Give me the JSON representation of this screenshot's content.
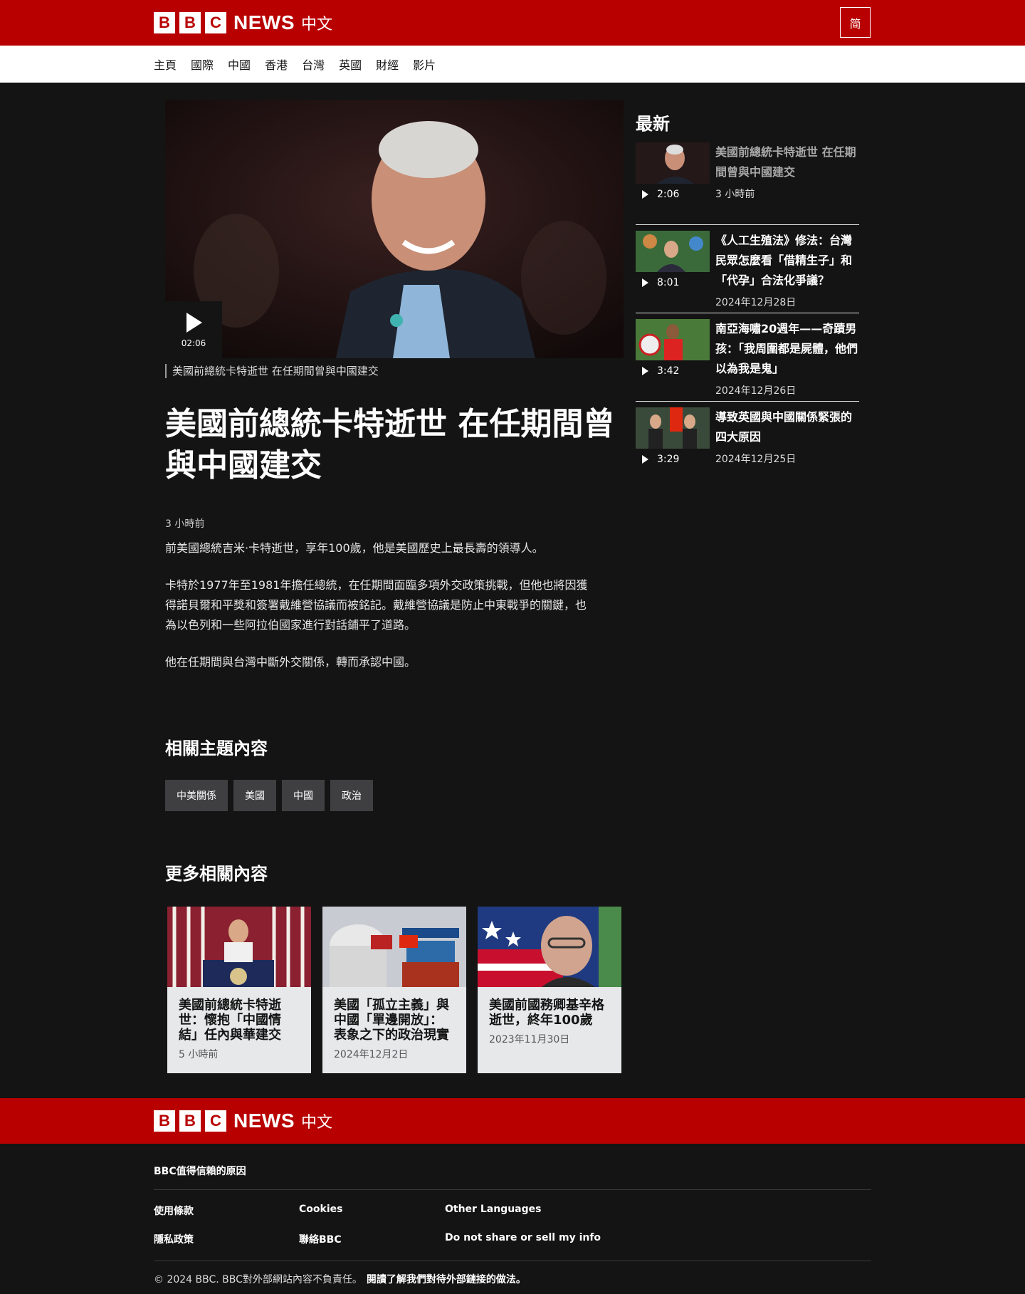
{
  "brand": {
    "letters": [
      "B",
      "B",
      "C"
    ],
    "news": "NEWS",
    "chinese": "中文"
  },
  "header": {
    "lang_toggle": "简"
  },
  "nav": [
    "主頁",
    "國際",
    "中國",
    "香港",
    "台灣",
    "英國",
    "財經",
    "影片"
  ],
  "video": {
    "duration": "02:06",
    "caption": "美國前總統卡特逝世 在任期間曾與中國建交"
  },
  "article": {
    "title": "美國前總統卡特逝世 在任期間曾與中國建交",
    "time": "3 小時前",
    "paragraphs": [
      "前美國總統吉米·卡特逝世，享年100歲，他是美國歷史上最長壽的領導人。",
      "卡特於1977年至1981年擔任總統，在任期間面臨多項外交政策挑戰，但他也將因獲得諾貝爾和平獎和簽署戴維營協議而被銘記。戴維營協議是防止中東戰爭的關鍵，也為以色列和一些阿拉伯國家進行對話鋪平了道路。",
      "他在任期間與台灣中斷外交關係，轉而承認中國。"
    ]
  },
  "topics": {
    "heading": "相關主題內容",
    "tags": [
      "中美關係",
      "美國",
      "中國",
      "政治"
    ]
  },
  "more": {
    "heading": "更多相關內容",
    "cards": [
      {
        "title": "美國前總統卡特逝世：懷抱「中國情結」任內與華建交",
        "date": "5 小時前"
      },
      {
        "title": "美國「孤立主義」與中國「單邊開放」：表象之下的政治現實",
        "date": "2024年12月2日"
      },
      {
        "title": "美國前國務卿基辛格逝世，終年100歲",
        "date": "2023年11月30日"
      }
    ]
  },
  "sidebar": {
    "heading": "最新",
    "items": [
      {
        "title": "美國前總統卡特逝世 在任期間曾與中國建交",
        "duration": "2:06",
        "date": "3 小時前"
      },
      {
        "title": "《人工生殖法》修法：台灣民眾怎麼看「借精生子」和「代孕」合法化爭議？",
        "duration": "8:01",
        "date": "2024年12月28日"
      },
      {
        "title": "南亞海嘯20週年——奇蹟男孩：「我周圍都是屍體，他們以為我是鬼」",
        "duration": "3:42",
        "date": "2024年12月26日"
      },
      {
        "title": "導致英國與中國關係緊張的四大原因",
        "duration": "3:29",
        "date": "2024年12月25日"
      }
    ]
  },
  "footer": {
    "why": "BBC值得信賴的原因",
    "links": [
      "使用條款",
      "Cookies",
      "Other Languages",
      "隱私政策",
      "聯絡BBC",
      "Do not share or sell my info"
    ],
    "copyright": "© 2024 BBC. BBC對外部網站內容不負責任。",
    "external": "閱讀了解我們對待外部鏈接的做法。"
  },
  "colors": {
    "brand_red": "#b80000",
    "page_bg": "#141414",
    "card_bg": "#e6e8ea",
    "tag_bg": "#3f3f42"
  }
}
